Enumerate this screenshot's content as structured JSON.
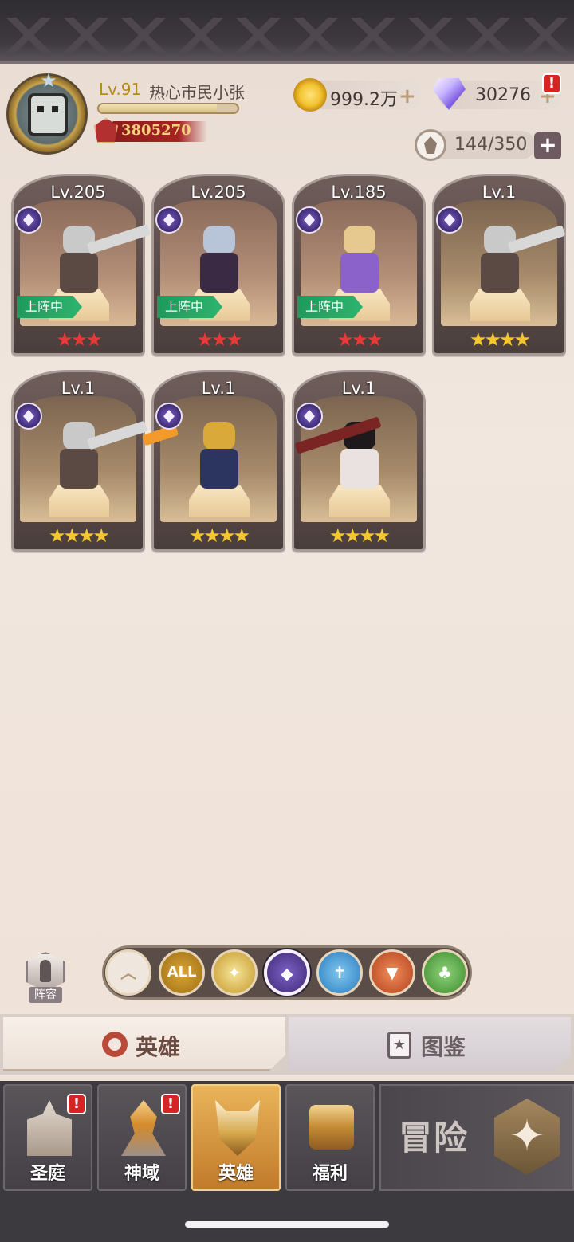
{
  "player": {
    "level": "Lv.91",
    "name": "热心市民小张",
    "power": "3805270",
    "exp_progress": 0.85
  },
  "currency": {
    "gold": "999.2万",
    "gems": "30276",
    "gems_alert": "!",
    "hero_capacity": "144/350"
  },
  "heroes": [
    {
      "level": "Lv.205",
      "stars": "★★★",
      "star_color": "red",
      "deployed": "上阵中"
    },
    {
      "level": "Lv.205",
      "stars": "★★★",
      "star_color": "red",
      "deployed": "上阵中"
    },
    {
      "level": "Lv.185",
      "stars": "★★★",
      "star_color": "red",
      "deployed": "上阵中"
    },
    {
      "level": "Lv.1",
      "stars": "★★★★",
      "star_color": "gold",
      "deployed": ""
    },
    {
      "level": "Lv.1",
      "stars": "★★★★",
      "star_color": "gold",
      "deployed": ""
    },
    {
      "level": "Lv.1",
      "stars": "★★★★",
      "star_color": "gold",
      "deployed": ""
    },
    {
      "level": "Lv.1",
      "stars": "★★★★",
      "star_color": "gold",
      "deployed": ""
    }
  ],
  "filters": {
    "lineup_label": "阵容",
    "all_label": "ALL",
    "selected": "dark"
  },
  "tabs": {
    "hero": "英雄",
    "book": "图鉴"
  },
  "nav": {
    "court": "圣庭",
    "divine": "神域",
    "hero": "英雄",
    "welfare": "福利",
    "adventure": "冒险",
    "alert": "!"
  },
  "colors": {
    "deploy_green": "#2db46e",
    "star_red": "#e33b3b",
    "star_gold": "#f4c731",
    "nav_active": "#e9b45a"
  }
}
